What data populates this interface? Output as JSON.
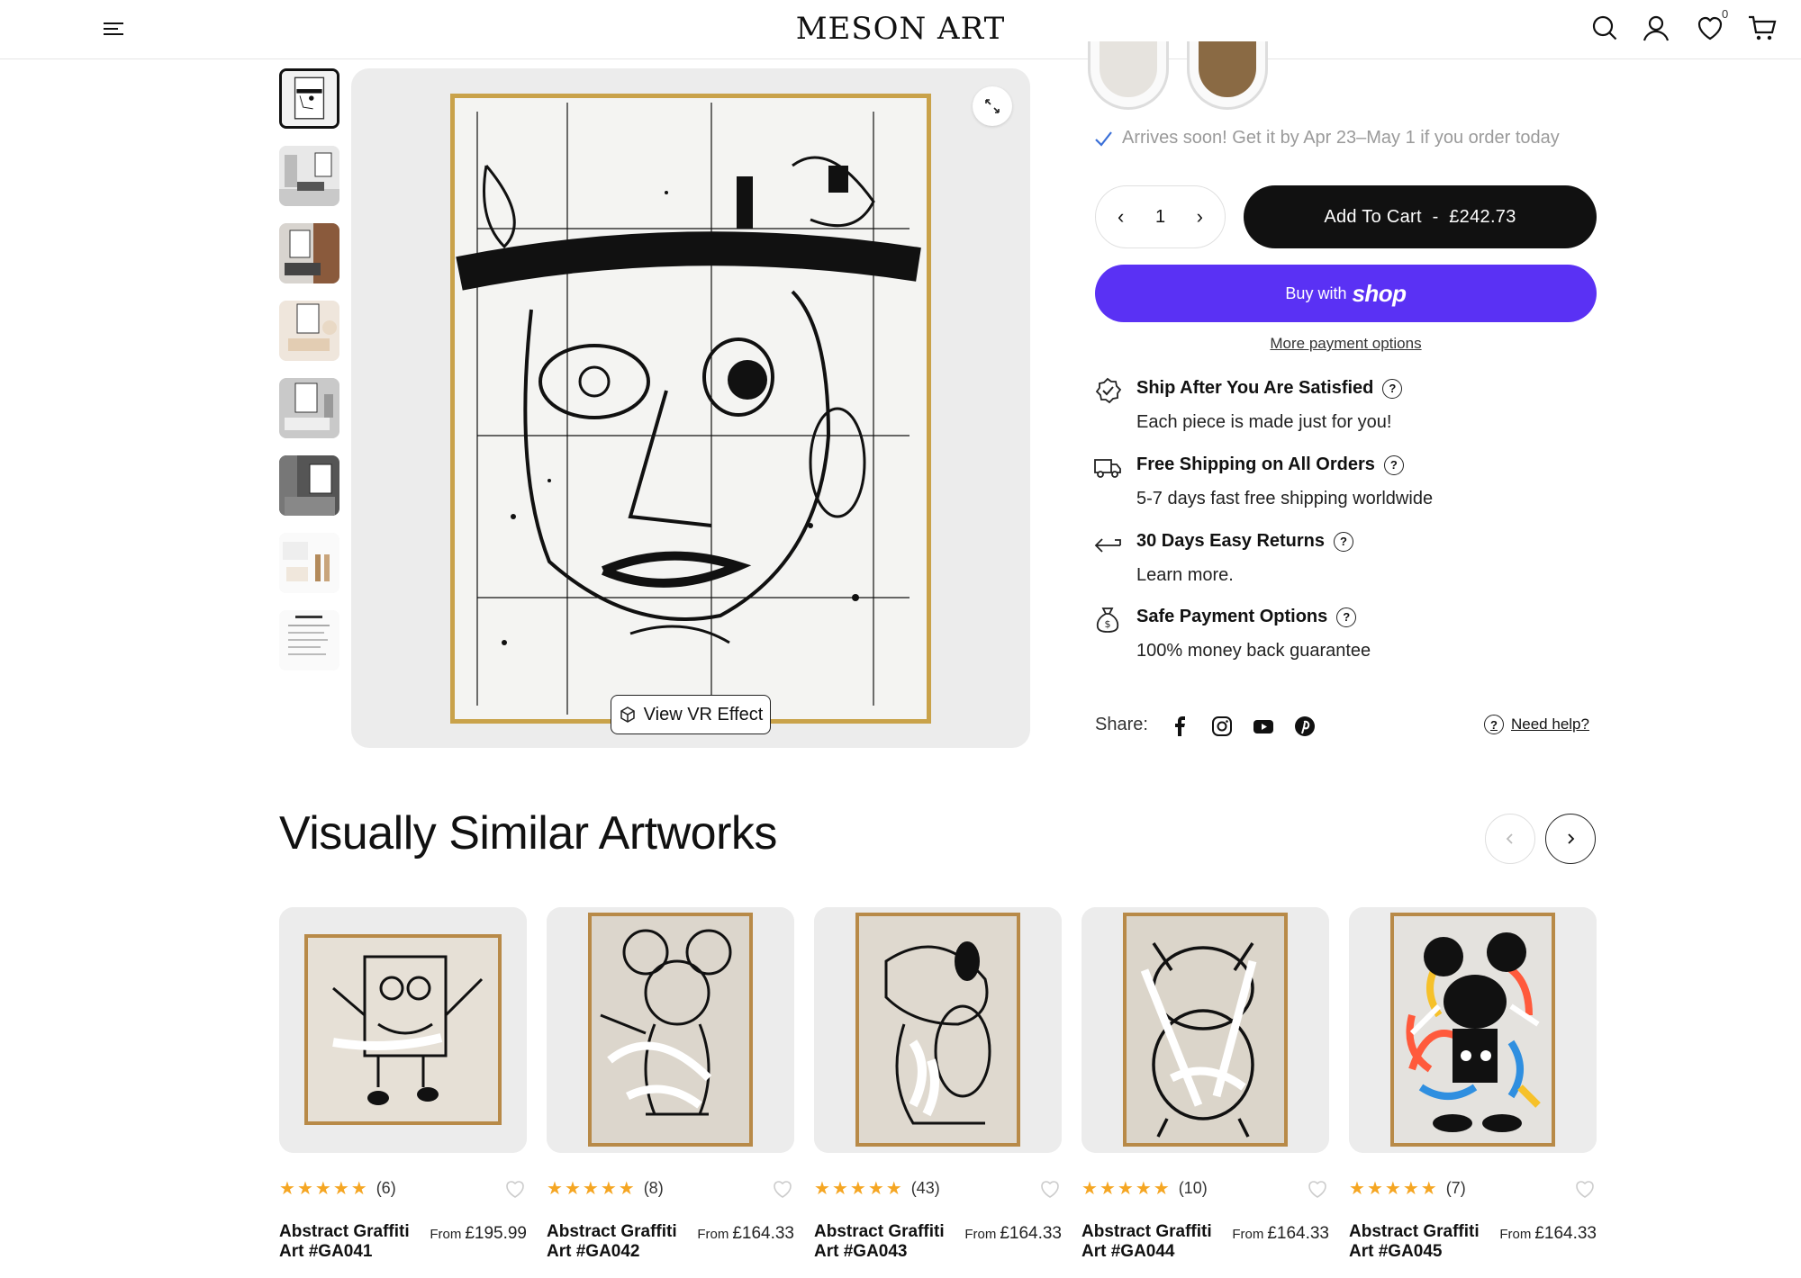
{
  "header": {
    "logo": "MESON ART",
    "wishlist_count": "0"
  },
  "gallery": {
    "vr_label": "View VR Effect"
  },
  "product": {
    "arrives_text": "Arrives soon! Get it by Apr 23–May 1 if you order today",
    "quantity": "1",
    "add_to_cart": "Add To Cart  -  £242.73",
    "buy_with": "Buy with",
    "shop": "shop",
    "more_payment": "More payment options",
    "features": [
      {
        "title": "Ship After You Are Satisfied",
        "sub": "Each piece is made just for you!",
        "icon": "badge-check-icon"
      },
      {
        "title": "Free Shipping on All Orders",
        "sub": "5-7 days fast free shipping worldwide",
        "icon": "truck-icon"
      },
      {
        "title": "30 Days Easy Returns",
        "sub": "Learn more.",
        "icon": "return-arrow-icon"
      },
      {
        "title": "Safe Payment Options",
        "sub": "100% money back guarantee",
        "icon": "money-bag-icon"
      }
    ],
    "share_label": "Share:",
    "need_help": "Need help?"
  },
  "similar": {
    "title": "Visually Similar Artworks",
    "items": [
      {
        "rating_count": "(6)",
        "name": "Abstract Graffiti Art #GA041",
        "from": "From",
        "price": "£195.99",
        "stars": 5
      },
      {
        "rating_count": "(8)",
        "name": "Abstract Graffiti Art #GA042",
        "from": "From",
        "price": "£164.33",
        "stars": 5
      },
      {
        "rating_count": "(43)",
        "name": "Abstract Graffiti Art #GA043",
        "from": "From",
        "price": "£164.33",
        "stars": 5
      },
      {
        "rating_count": "(10)",
        "name": "Abstract Graffiti Art #GA044",
        "from": "From",
        "price": "£164.33",
        "stars": 5
      },
      {
        "rating_count": "(7)",
        "name": "Abstract Graffiti Art #GA045",
        "from": "From",
        "price": "£164.33",
        "stars": 5
      }
    ]
  },
  "colors": {
    "shop_purple": "#5a31f4",
    "star": "#f5a623",
    "check_blue": "#3a6fd8"
  }
}
